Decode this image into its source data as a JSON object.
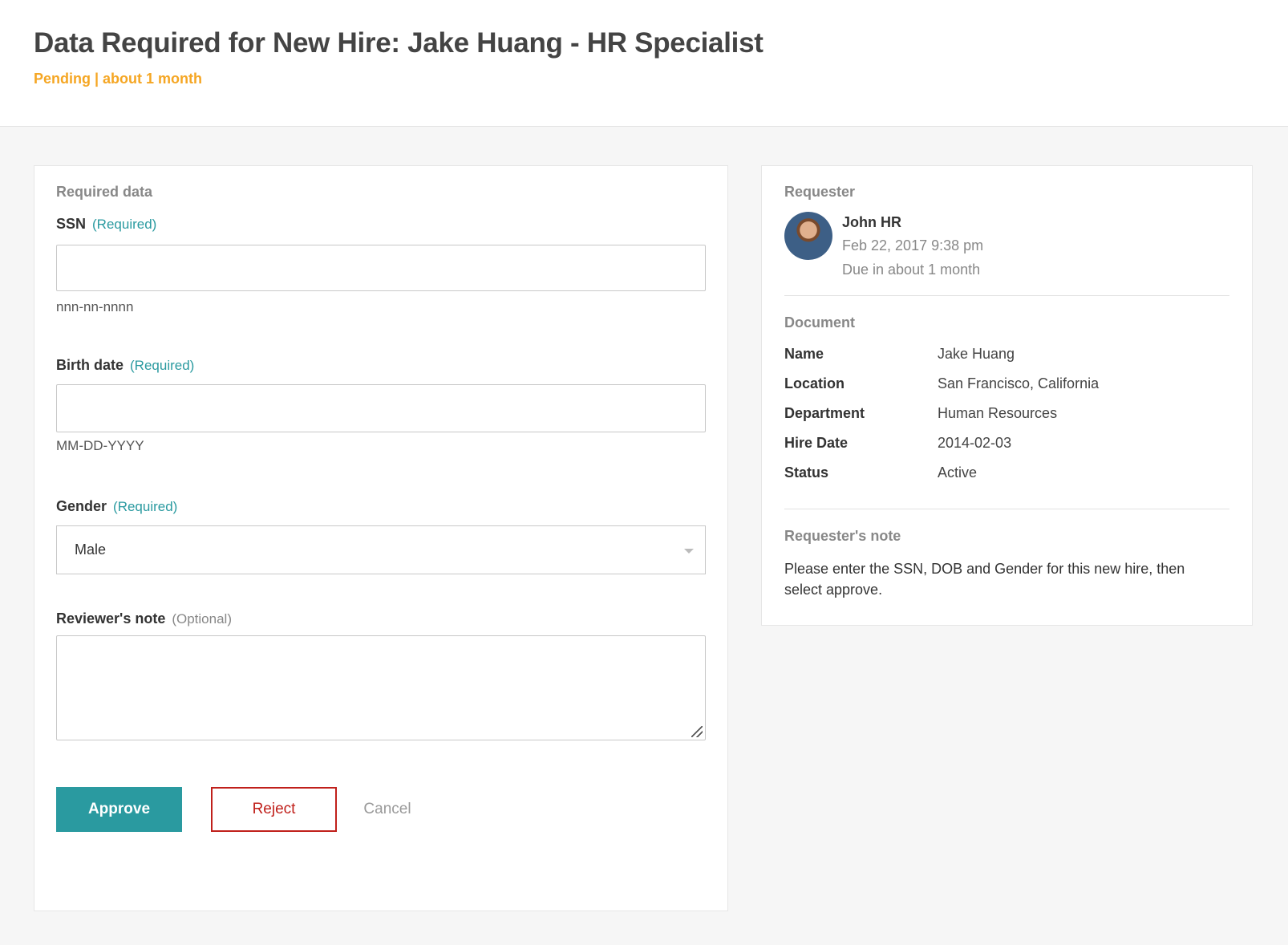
{
  "header": {
    "title": "Data Required for New Hire: Jake Huang - HR Specialist",
    "status": "Pending | about 1 month"
  },
  "form": {
    "section_title": "Required data",
    "ssn": {
      "label": "SSN",
      "required": "(Required)",
      "value": "",
      "hint": "nnn-nn-nnnn"
    },
    "birth_date": {
      "label": "Birth date",
      "required": "(Required)",
      "value": "",
      "hint": "MM-DD-YYYY"
    },
    "gender": {
      "label": "Gender",
      "required": "(Required)",
      "selected": "Male"
    },
    "reviewer_note": {
      "label": "Reviewer's note",
      "optional": "(Optional)",
      "value": ""
    },
    "buttons": {
      "approve": "Approve",
      "reject": "Reject",
      "cancel": "Cancel"
    }
  },
  "requester": {
    "section_title": "Requester",
    "name": "John HR",
    "date": "Feb 22, 2017 9:38 pm",
    "due": "Due in about 1 month"
  },
  "document": {
    "section_title": "Document",
    "rows": [
      {
        "key": "Name",
        "value": "Jake Huang"
      },
      {
        "key": "Location",
        "value": "San Francisco, California"
      },
      {
        "key": "Department",
        "value": "Human Resources"
      },
      {
        "key": "Hire Date",
        "value": "2014-02-03"
      },
      {
        "key": "Status",
        "value": "Active"
      }
    ]
  },
  "requester_note": {
    "section_title": "Requester's note",
    "text": "Please enter the SSN, DOB and Gender for this new hire, then select approve."
  },
  "colors": {
    "accent": "#2a9aa0",
    "pending": "#f5a623",
    "reject": "#c0201b"
  }
}
